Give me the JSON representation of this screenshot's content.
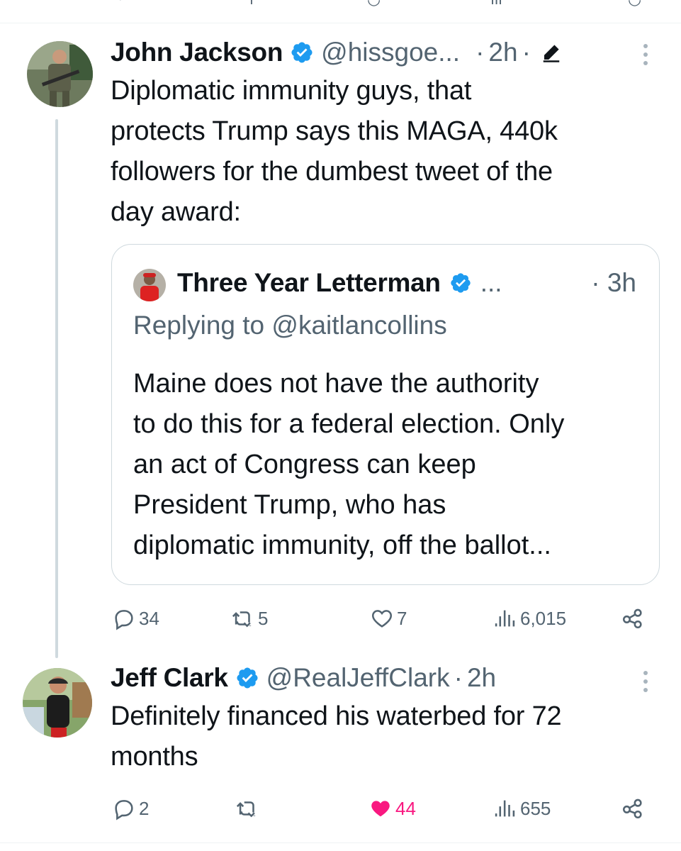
{
  "tweet1": {
    "name": "John Jackson",
    "handle": "@hissgoe...",
    "time": "2h",
    "text_lines": [
      "Diplomatic immunity guys, that",
      "protects Trump says this MAGA, 440k",
      "followers for the dumbest tweet of the",
      "day award:"
    ],
    "quote": {
      "name": "Three Year Letterman",
      "ellipsis": "...",
      "time": "· 3h",
      "replying_to": "Replying to @kaitlancollins",
      "text_lines": [
        "Maine does not have the authority",
        "to do this for a federal election. Only",
        "an act of Congress can keep",
        "President Trump, who has",
        "diplomatic immunity, off the ballot..."
      ]
    },
    "stats": {
      "replies": "34",
      "reposts": "5",
      "likes": "7",
      "views": "6,015"
    }
  },
  "tweet2": {
    "name": "Jeff Clark",
    "handle": "@RealJeffClark",
    "time": "2h",
    "text_lines": [
      "Definitely financed his waterbed for 72",
      "months"
    ],
    "stats": {
      "replies": "2",
      "reposts": "",
      "likes": "44",
      "views": "655"
    }
  },
  "colors": {
    "accent_blue": "#1d9bf0",
    "like_pink": "#f91880",
    "secondary": "#536471"
  },
  "icons": [
    "verified-badge-icon",
    "edit-icon",
    "more-icon",
    "reply-icon",
    "repost-icon",
    "like-icon",
    "like-filled-icon",
    "views-icon",
    "share-icon"
  ]
}
